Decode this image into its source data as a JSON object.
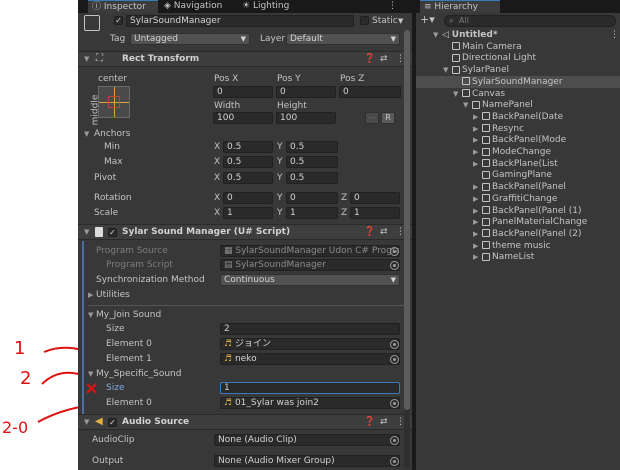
{
  "inspector": {
    "tab_inspector": "Inspector",
    "tab_navigation": "Navigation",
    "tab_lighting": "Lighting",
    "object_name": "SylarSoundManager",
    "static_label": "Static",
    "tag_label": "Tag",
    "tag_value": "Untagged",
    "layer_label": "Layer",
    "layer_value": "Default",
    "rect_transform": {
      "title": "Rect Transform",
      "anchor_preset_h": "center",
      "anchor_preset_v": "middle",
      "pos_x_label": "Pos X",
      "pos_y_label": "Pos Y",
      "pos_z_label": "Pos Z",
      "pos_x": "0",
      "pos_y": "0",
      "pos_z": "0",
      "width_label": "Width",
      "height_label": "Height",
      "width": "100",
      "height": "100",
      "r_button": "R",
      "anchors_label": "Anchors",
      "min_label": "Min",
      "max_label": "Max",
      "pivot_label": "Pivot",
      "min_x": "0.5",
      "min_y": "0.5",
      "max_x": "0.5",
      "max_y": "0.5",
      "pivot_x": "0.5",
      "pivot_y": "0.5",
      "rotation_label": "Rotation",
      "rot_x": "0",
      "rot_y": "0",
      "rot_z": "0",
      "scale_label": "Scale",
      "scale_x": "1",
      "scale_y": "1",
      "scale_z": "1",
      "x": "X",
      "y": "Y",
      "z": "Z"
    },
    "sound_manager": {
      "title": "Sylar Sound Manager (U# Script)",
      "program_source_label": "Program Source",
      "program_source_value": "SylarSoundManager Udon C# Program",
      "program_script_label": "Program Script",
      "program_script_value": "SylarSoundManager",
      "sync_method_label": "Synchronization Method",
      "sync_method_value": "Continuous",
      "utilities_label": "Utilities",
      "join_sound_label": "My_Join Sound",
      "size_label": "Size",
      "join_size": "2",
      "element0_label": "Element 0",
      "element1_label": "Element 1",
      "join_el0": "ジョイン",
      "join_el1": "neko",
      "specific_label": "My_Specific_Sound",
      "specific_size": "1",
      "specific_el0": "01_Sylar was join2"
    },
    "audio_source": {
      "title": "Audio Source",
      "clip_label": "AudioClip",
      "clip_value": "None (Audio Clip)",
      "output_label": "Output",
      "output_value": "None (Audio Mixer Group)"
    }
  },
  "hierarchy": {
    "tab": "Hierarchy",
    "search_placeholder": "All",
    "items": [
      {
        "label": "Untitled*",
        "depth": 0
      },
      {
        "label": "Main Camera",
        "depth": 1
      },
      {
        "label": "Directional Light",
        "depth": 1
      },
      {
        "label": "SylarPanel",
        "depth": 1
      },
      {
        "label": "SylarSoundManager",
        "depth": 2
      },
      {
        "label": "Canvas",
        "depth": 2
      },
      {
        "label": "NamePanel",
        "depth": 3
      },
      {
        "label": "BackPanel(Date",
        "depth": 4
      },
      {
        "label": "Resync",
        "depth": 4
      },
      {
        "label": "BackPanel(Mode",
        "depth": 4
      },
      {
        "label": "ModeChange",
        "depth": 4
      },
      {
        "label": "BackPlane(List",
        "depth": 4
      },
      {
        "label": "GamingPlane",
        "depth": 4
      },
      {
        "label": "BackPanel(Panel",
        "depth": 4
      },
      {
        "label": "GraffitiChange",
        "depth": 4
      },
      {
        "label": "BackPanel(Panel (1)",
        "depth": 4
      },
      {
        "label": "PanelMaterialChange",
        "depth": 4
      },
      {
        "label": "BackPanel(Panel (2)",
        "depth": 4
      },
      {
        "label": "theme music",
        "depth": 4
      },
      {
        "label": "NameList",
        "depth": 4
      }
    ]
  },
  "annotations": {
    "a1": "1",
    "a2": "2",
    "a3": "2-0",
    "x_mark": "×"
  },
  "colors": {
    "panel_bg": "#383838",
    "header_bg": "#3e3e3e",
    "selection": "#4d4d4d",
    "annotation": "#e01010",
    "accent": "#3a79bb"
  }
}
